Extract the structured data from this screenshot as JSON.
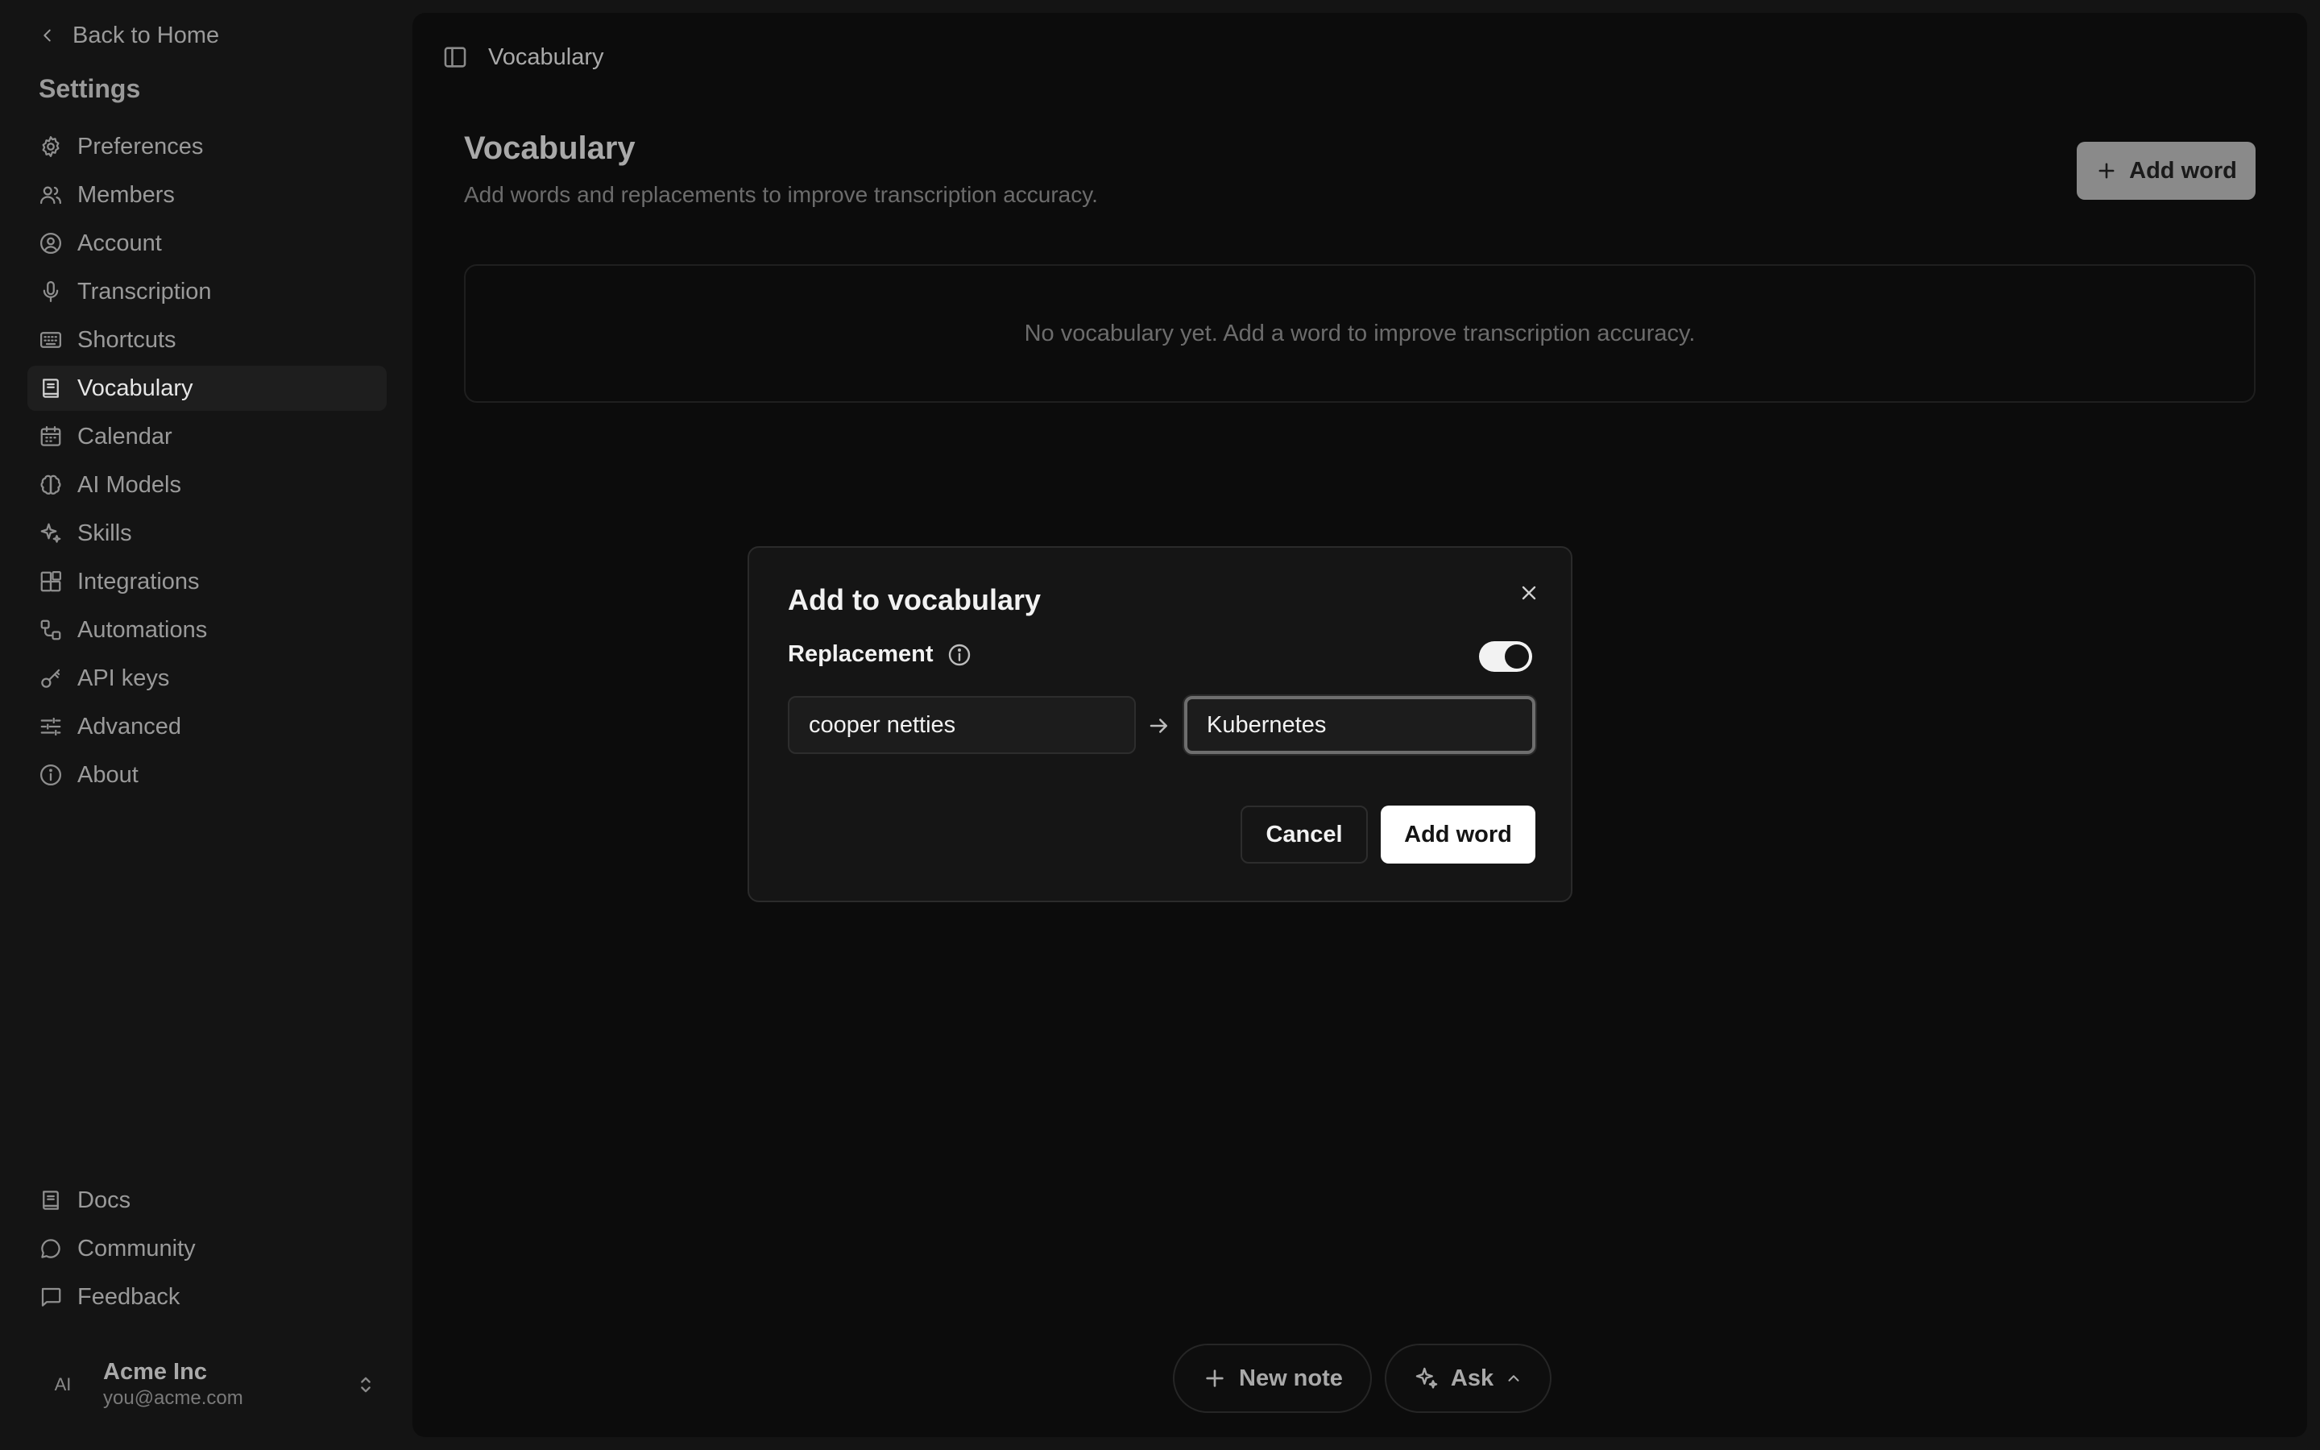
{
  "sidebar": {
    "back_label": "Back to Home",
    "title": "Settings",
    "items": [
      {
        "label": "Preferences",
        "icon": "gear-icon"
      },
      {
        "label": "Members",
        "icon": "users-icon"
      },
      {
        "label": "Account",
        "icon": "user-circle-icon"
      },
      {
        "label": "Transcription",
        "icon": "microphone-icon"
      },
      {
        "label": "Shortcuts",
        "icon": "keyboard-icon"
      },
      {
        "label": "Vocabulary",
        "icon": "book-icon",
        "active": true
      },
      {
        "label": "Calendar",
        "icon": "calendar-icon"
      },
      {
        "label": "AI Models",
        "icon": "brain-icon"
      },
      {
        "label": "Skills",
        "icon": "sparkles-icon"
      },
      {
        "label": "Integrations",
        "icon": "blocks-icon"
      },
      {
        "label": "Automations",
        "icon": "workflow-icon"
      },
      {
        "label": "API keys",
        "icon": "key-icon"
      },
      {
        "label": "Advanced",
        "icon": "sliders-icon"
      },
      {
        "label": "About",
        "icon": "info-icon"
      }
    ],
    "bottom_items": [
      {
        "label": "Docs",
        "icon": "book-icon"
      },
      {
        "label": "Community",
        "icon": "chat-bubble-icon"
      },
      {
        "label": "Feedback",
        "icon": "message-square-icon"
      }
    ],
    "user": {
      "avatar_initials": "AI",
      "name": "Acme Inc",
      "email": "you@acme.com"
    }
  },
  "main": {
    "breadcrumb": "Vocabulary",
    "title": "Vocabulary",
    "subtitle": "Add words and replacements to improve transcription accuracy.",
    "add_word_label": "Add word",
    "empty_message": "No vocabulary yet. Add a word to improve transcription accuracy."
  },
  "bottom_bar": {
    "new_note_label": "New note",
    "ask_label": "Ask"
  },
  "modal": {
    "title": "Add to vocabulary",
    "replacement_label": "Replacement",
    "replacement_enabled": true,
    "from_value": "cooper netties",
    "to_value": "Kubernetes",
    "cancel_label": "Cancel",
    "add_label": "Add word"
  },
  "colors": {
    "background": "#141414",
    "panel": "#0c0c0c",
    "modal": "#151515",
    "primary_button": "#ffffff"
  }
}
